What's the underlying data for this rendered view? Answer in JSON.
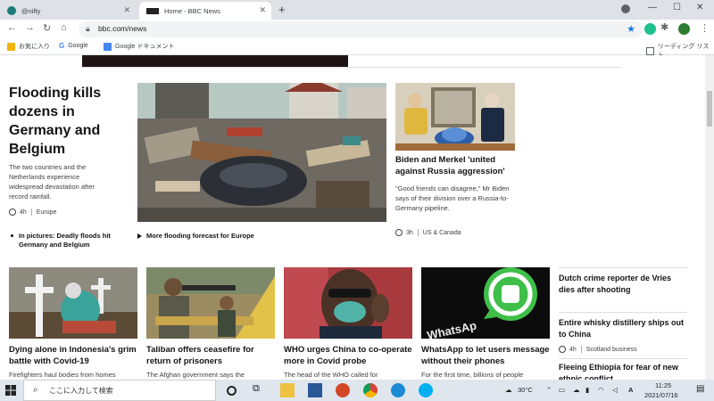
{
  "browser": {
    "tabs": [
      {
        "title": "@nifty",
        "active": false,
        "favicon_color": "#1e7c77"
      },
      {
        "title": "Home - BBC News",
        "active": true,
        "favicon_color": "#222222"
      }
    ],
    "new_tab_label": "+",
    "url": "bbc.com/news",
    "bookmarks": [
      {
        "label": "お気に入り",
        "icon": "folder-icon"
      },
      {
        "label": "Google",
        "icon": "google-icon"
      },
      {
        "label": "Google ドキュメント",
        "icon": "docs-icon"
      }
    ],
    "reading_list": "リーディング リスト"
  },
  "lead_story": {
    "headline": "Flooding kills dozens in Germany and Belgium",
    "summary": "The two countries and the Netherlands experience widespread devastation after record rainfall.",
    "time": "4h",
    "section": "Europe",
    "related": [
      {
        "label": "In pictures: Deadly floods hit Germany and Belgium",
        "type": "bullet"
      },
      {
        "label": "More flooding forecast for Europe",
        "type": "video"
      }
    ]
  },
  "side_story": {
    "headline": "Biden and Merkel 'united against Russia aggression'",
    "summary": "\"Good friends can disagree,\" Mr Biden says of their division over a Russia-to-Germany pipeline.",
    "time": "3h",
    "section": "US & Canada"
  },
  "grid_stories": [
    {
      "headline": "Dying alone in Indonesia's grim battle with Covid-19",
      "summary": "Firefighters haul bodies from homes"
    },
    {
      "headline": "Taliban offers ceasefire for return of prisoners",
      "summary": "The Afghan government says the"
    },
    {
      "headline": "WHO urges China to co-operate more in Covid probe",
      "summary": "The head of the WHO called for"
    },
    {
      "headline": "WhatsApp to let users message without their phones",
      "summary": "For the first time, billions of people"
    }
  ],
  "right_list": [
    {
      "headline": "Dutch crime reporter de Vries dies after shooting"
    },
    {
      "headline": "Entire whisky distillery ships out to China",
      "time": "4h",
      "section": "Scotland business"
    },
    {
      "headline": "Fleeing Ethiopia for fear of new ethnic conflict"
    }
  ],
  "taskbar": {
    "search_placeholder": "ここに入力して検索",
    "temperature": "30°C",
    "time": "11:25",
    "date": "2021/07/16",
    "ime": "A"
  }
}
